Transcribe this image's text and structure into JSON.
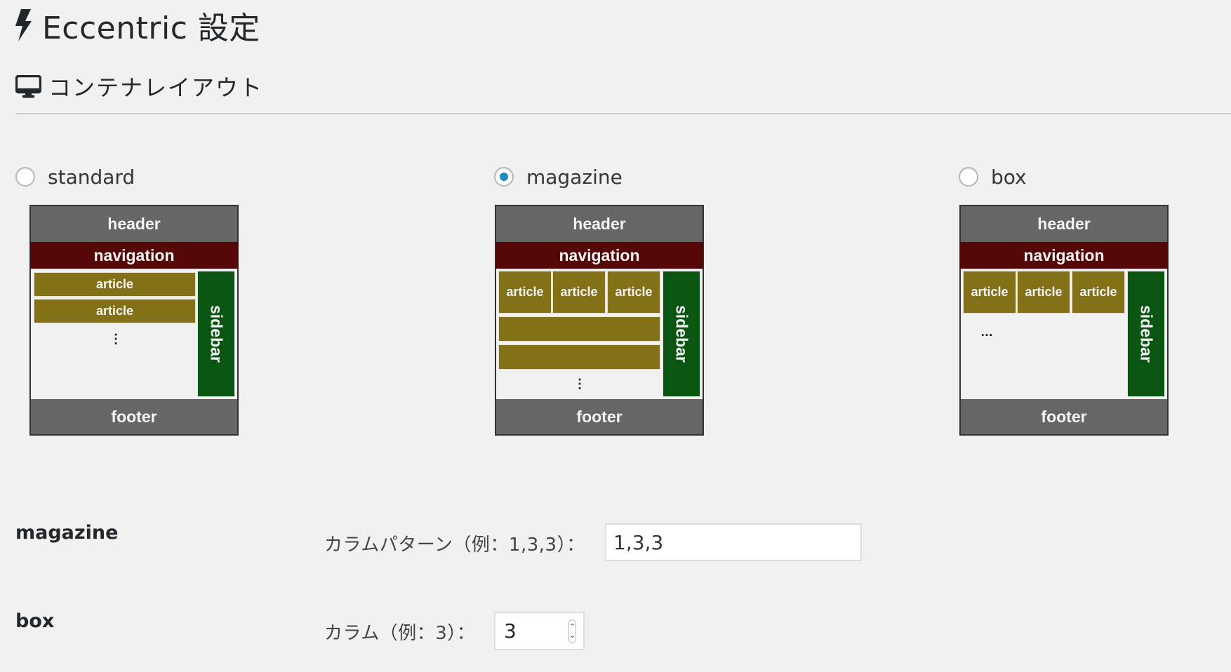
{
  "page": {
    "title": "Eccentric 設定",
    "title_icon": "bolt-icon",
    "section_title": "コンテナレイアウト",
    "section_icon": "desktop-monitor-icon"
  },
  "layout_options": [
    {
      "value": "standard",
      "label": "standard",
      "checked": false,
      "diagram": {
        "header": "header",
        "navigation": "navigation",
        "articles": [
          "article",
          "article"
        ],
        "ellipsis": "⋮",
        "sidebar": "sidebar",
        "footer": "footer"
      }
    },
    {
      "value": "magazine",
      "label": "magazine",
      "checked": true,
      "diagram": {
        "header": "header",
        "navigation": "navigation",
        "articles": [
          "article",
          "article",
          "article"
        ],
        "ellipsis": "⋮",
        "sidebar": "sidebar",
        "footer": "footer"
      }
    },
    {
      "value": "box",
      "label": "box",
      "checked": false,
      "diagram": {
        "header": "header",
        "navigation": "navigation",
        "articles": [
          "article",
          "article",
          "article"
        ],
        "ellipsis": "…",
        "sidebar": "sidebar",
        "footer": "footer"
      }
    }
  ],
  "settings": {
    "magazine": {
      "label": "magazine",
      "field_label": "カラムパターン（例：1,3,3）：",
      "value": "1,3,3"
    },
    "box": {
      "label": "box",
      "field_label": "カラム（例：3）：",
      "value": "3"
    }
  },
  "colors": {
    "header_footer": "#666666",
    "navigation": "#550606",
    "article": "#837118",
    "sidebar": "#0b5513",
    "radio_checked": "#1e8cbe"
  }
}
